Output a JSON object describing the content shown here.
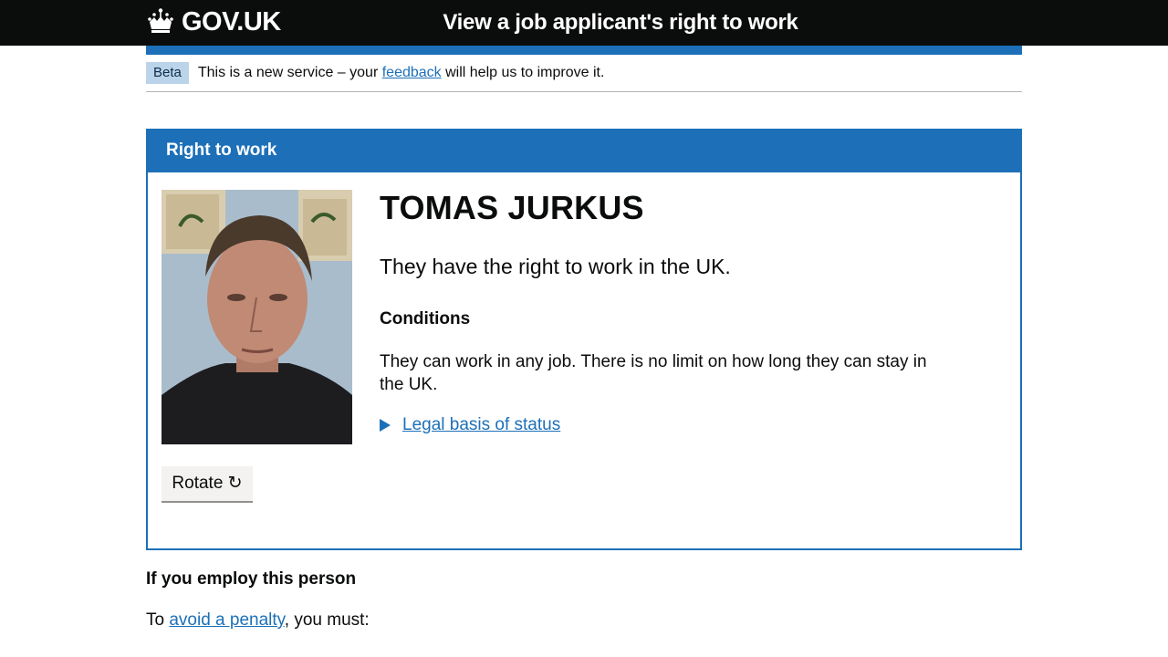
{
  "header": {
    "logo_text": "GOV.UK",
    "service_name": "View a job applicant's right to work",
    "colors": {
      "background": "#0b0c0c",
      "accent": "#1d70b8"
    }
  },
  "phase_banner": {
    "tag": "Beta",
    "text_before": "This is a new service – your ",
    "link": "feedback",
    "text_after": " will help us to improve it."
  },
  "panel": {
    "heading": "Right to work",
    "photo_icon": "applicant-photo",
    "rotate_label": "Rotate ↻",
    "name": "TOMAS JURKUS",
    "status": "They have the right to work in the UK.",
    "conditions_heading": "Conditions",
    "conditions_text": "They can work in any job. There is no limit on how long they can stay in the UK.",
    "legal_link": "Legal basis of status"
  },
  "employ": {
    "heading": "If you employ this person",
    "text_before": "To ",
    "link": "avoid a penalty",
    "text_after": ", you must:"
  }
}
